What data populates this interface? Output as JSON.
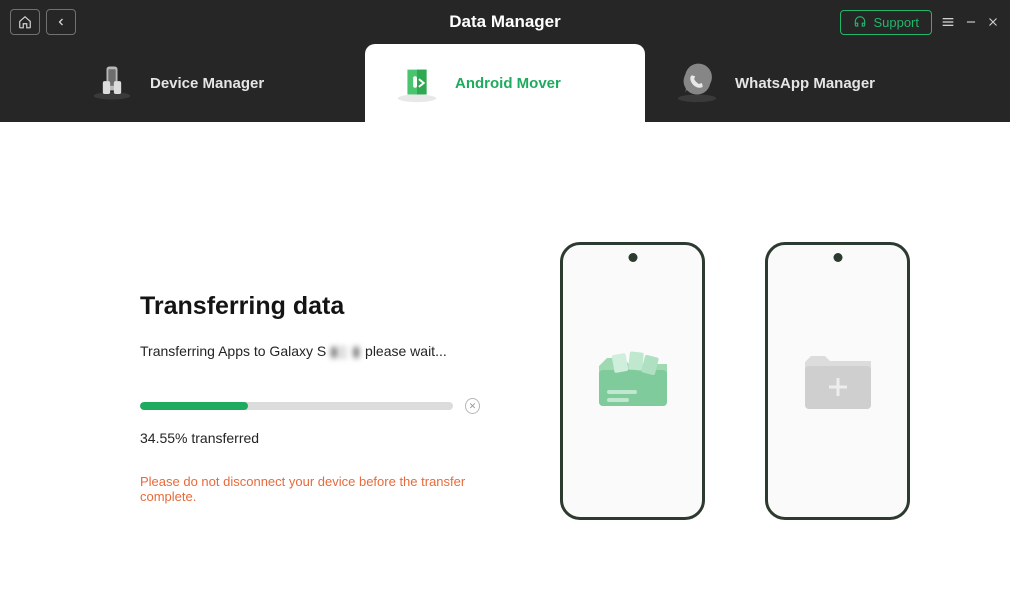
{
  "app": {
    "title": "Data Manager"
  },
  "titlebar": {
    "support": "Support"
  },
  "tabs": [
    {
      "label": "Device Manager"
    },
    {
      "label": "Android Mover"
    },
    {
      "label": "WhatsApp Manager"
    }
  ],
  "transfer": {
    "heading": "Transferring data",
    "status_prefix": "Transferring Apps to Galaxy S ",
    "status_masked": "▮▯ ▮",
    "status_suffix": " please wait...",
    "progress_percent": 34.55,
    "percent_text": "34.55% transferred",
    "warning": "Please do not disconnect your device before the transfer complete."
  }
}
